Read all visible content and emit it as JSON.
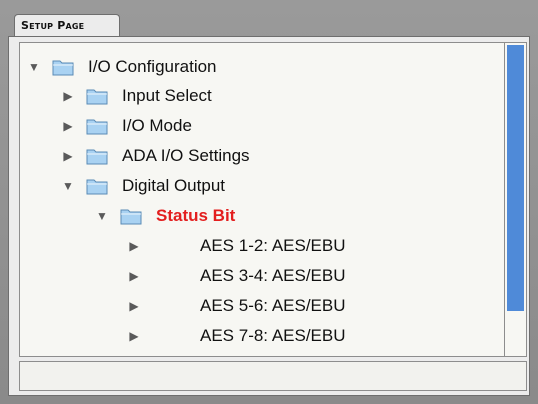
{
  "window": {
    "tab_label": "Setup Page"
  },
  "tree": {
    "root": {
      "label": "I/O Configuration",
      "expanded": true
    },
    "children": [
      {
        "label": "Input Select",
        "expanded": false
      },
      {
        "label": "I/O Mode",
        "expanded": false
      },
      {
        "label": "ADA I/O Settings",
        "expanded": false
      },
      {
        "label": "Digital Output",
        "expanded": true
      }
    ],
    "digital_output": {
      "child": {
        "label": "Status Bit",
        "expanded": true,
        "highlight_color": "#e31e1e"
      },
      "items": [
        {
          "label": "AES 1-2:  AES/EBU"
        },
        {
          "label": "AES 3-4:  AES/EBU"
        },
        {
          "label": "AES 5-6:  AES/EBU"
        },
        {
          "label": "AES 7-8:  AES/EBU"
        }
      ]
    }
  },
  "colors": {
    "scrollbar": "#4f8ad8",
    "selected_text": "#e31e1e"
  },
  "icons": {
    "folder": "folder-icon",
    "expand": "triangle-down-icon",
    "collapse": "triangle-right-icon"
  }
}
